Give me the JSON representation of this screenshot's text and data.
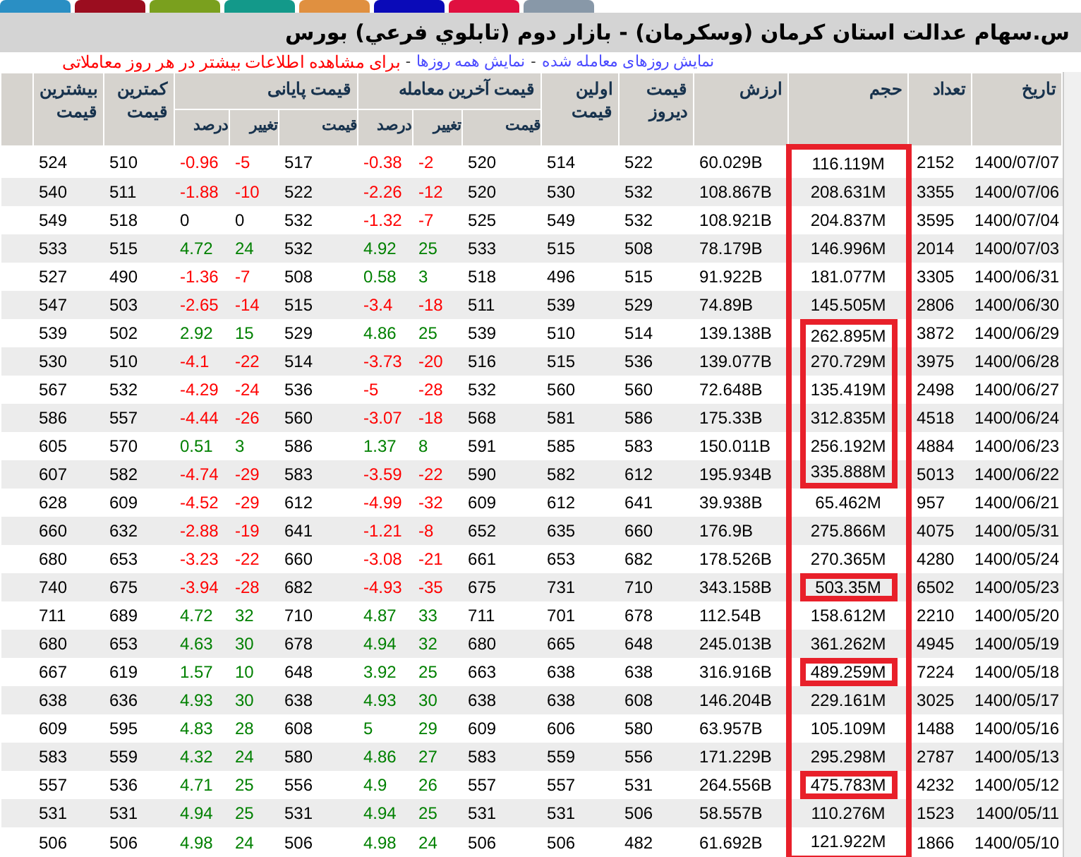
{
  "top_tabs": [
    {
      "color": "#2a8fc4"
    },
    {
      "color": "#9b0d1f"
    },
    {
      "color": "#7aa01e"
    },
    {
      "color": "#13998a"
    },
    {
      "color": "#e09040"
    },
    {
      "color": "#0a0ab8"
    },
    {
      "color": "#e01040"
    },
    {
      "color": "#8898a8"
    }
  ],
  "title": "س.سهام عدالت استان کرمان (وسکرمان) - بازار دوم (تابلوي فرعي) بورس",
  "links": [
    {
      "kind": "link",
      "text": "نمایش روزهای معامله شده"
    },
    {
      "kind": "separator",
      "text": "-"
    },
    {
      "kind": "link",
      "text": "نمایش همه روزها"
    },
    {
      "kind": "separator",
      "text": "-"
    },
    {
      "kind": "note",
      "text": "برای مشاهده اطلاعات بیشتر در هر روز معاملاتی"
    }
  ],
  "table": {
    "columns": [
      {
        "label": "تاریخ"
      },
      {
        "label": "تعداد"
      },
      {
        "label": "حجم"
      },
      {
        "label": "ارزش"
      },
      {
        "label": "قیمت دیروز"
      },
      {
        "label": "اولین قیمت"
      },
      {
        "label": "قیمت آخرین معامله",
        "sub": [
          "قیمت",
          "تغییر",
          "درصد"
        ]
      },
      {
        "label": "قیمت پایانی",
        "sub": [
          "قیمت",
          "تغییر",
          "درصد"
        ]
      },
      {
        "label": "کمترین قیمت"
      },
      {
        "label": "بیشترین قیمت"
      }
    ],
    "rows": [
      {
        "date": "1400/07/07",
        "count": "2152",
        "volume": "116.119M",
        "boxed": false,
        "value": "60.029B",
        "yesterday": "522",
        "first": "514",
        "last": {
          "price": "520",
          "change": "-2",
          "percent": "-0.38",
          "color": "#ff0000"
        },
        "close": {
          "price": "517",
          "change": "-5",
          "percent": "-0.96",
          "color": "#ff0000"
        },
        "min": "510",
        "max": "524"
      },
      {
        "date": "1400/07/06",
        "count": "3355",
        "volume": "208.631M",
        "boxed": false,
        "value": "108.867B",
        "yesterday": "532",
        "first": "530",
        "last": {
          "price": "520",
          "change": "-12",
          "percent": "-2.26",
          "color": "#ff0000"
        },
        "close": {
          "price": "522",
          "change": "-10",
          "percent": "-1.88",
          "color": "#ff0000"
        },
        "min": "511",
        "max": "540"
      },
      {
        "date": "1400/07/04",
        "count": "3595",
        "volume": "204.837M",
        "boxed": false,
        "value": "108.921B",
        "yesterday": "532",
        "first": "549",
        "last": {
          "price": "525",
          "change": "-7",
          "percent": "-1.32",
          "color": "#ff0000"
        },
        "close": {
          "price": "532",
          "change": "0",
          "percent": "0",
          "color": "#000000"
        },
        "min": "518",
        "max": "549"
      },
      {
        "date": "1400/07/03",
        "count": "2014",
        "volume": "146.996M",
        "boxed": false,
        "value": "78.179B",
        "yesterday": "508",
        "first": "515",
        "last": {
          "price": "533",
          "change": "25",
          "percent": "4.92",
          "color": "#008000"
        },
        "close": {
          "price": "532",
          "change": "24",
          "percent": "4.72",
          "color": "#008000"
        },
        "min": "515",
        "max": "533"
      },
      {
        "date": "1400/06/31",
        "count": "3305",
        "volume": "181.077M",
        "boxed": false,
        "value": "91.922B",
        "yesterday": "515",
        "first": "496",
        "last": {
          "price": "518",
          "change": "3",
          "percent": "0.58",
          "color": "#008000"
        },
        "close": {
          "price": "508",
          "change": "-7",
          "percent": "-1.36",
          "color": "#ff0000"
        },
        "min": "490",
        "max": "527"
      },
      {
        "date": "1400/06/30",
        "count": "2806",
        "volume": "145.505M",
        "boxed": false,
        "value": "74.89B",
        "yesterday": "529",
        "first": "539",
        "last": {
          "price": "511",
          "change": "-18",
          "percent": "-3.4",
          "color": "#ff0000"
        },
        "close": {
          "price": "515",
          "change": "-14",
          "percent": "-2.65",
          "color": "#ff0000"
        },
        "min": "503",
        "max": "547"
      },
      {
        "date": "1400/06/29",
        "count": "3872",
        "volume": "262.895M",
        "boxed": true,
        "value": "139.138B",
        "yesterday": "514",
        "first": "510",
        "last": {
          "price": "539",
          "change": "25",
          "percent": "4.86",
          "color": "#008000"
        },
        "close": {
          "price": "529",
          "change": "15",
          "percent": "2.92",
          "color": "#008000"
        },
        "min": "502",
        "max": "539"
      },
      {
        "date": "1400/06/28",
        "count": "3975",
        "volume": "270.729M",
        "boxed": true,
        "value": "139.077B",
        "yesterday": "536",
        "first": "515",
        "last": {
          "price": "516",
          "change": "-20",
          "percent": "-3.73",
          "color": "#ff0000"
        },
        "close": {
          "price": "514",
          "change": "-22",
          "percent": "-4.1",
          "color": "#ff0000"
        },
        "min": "510",
        "max": "530"
      },
      {
        "date": "1400/06/27",
        "count": "2498",
        "volume": "135.419M",
        "boxed": true,
        "value": "72.648B",
        "yesterday": "560",
        "first": "560",
        "last": {
          "price": "532",
          "change": "-28",
          "percent": "-5",
          "color": "#ff0000"
        },
        "close": {
          "price": "536",
          "change": "-24",
          "percent": "-4.29",
          "color": "#ff0000"
        },
        "min": "532",
        "max": "567"
      },
      {
        "date": "1400/06/24",
        "count": "4518",
        "volume": "312.835M",
        "boxed": true,
        "value": "175.33B",
        "yesterday": "586",
        "first": "581",
        "last": {
          "price": "568",
          "change": "-18",
          "percent": "-3.07",
          "color": "#ff0000"
        },
        "close": {
          "price": "560",
          "change": "-26",
          "percent": "-4.44",
          "color": "#ff0000"
        },
        "min": "557",
        "max": "586"
      },
      {
        "date": "1400/06/23",
        "count": "4884",
        "volume": "256.192M",
        "boxed": true,
        "value": "150.011B",
        "yesterday": "583",
        "first": "585",
        "last": {
          "price": "591",
          "change": "8",
          "percent": "1.37",
          "color": "#008000"
        },
        "close": {
          "price": "586",
          "change": "3",
          "percent": "0.51",
          "color": "#008000"
        },
        "min": "570",
        "max": "605"
      },
      {
        "date": "1400/06/22",
        "count": "5013",
        "volume": "335.888M",
        "boxed": true,
        "value": "195.934B",
        "yesterday": "612",
        "first": "582",
        "last": {
          "price": "590",
          "change": "-22",
          "percent": "-3.59",
          "color": "#ff0000"
        },
        "close": {
          "price": "583",
          "change": "-29",
          "percent": "-4.74",
          "color": "#ff0000"
        },
        "min": "582",
        "max": "607"
      },
      {
        "date": "1400/06/21",
        "count": "957",
        "volume": "65.462M",
        "boxed": false,
        "value": "39.938B",
        "yesterday": "641",
        "first": "612",
        "last": {
          "price": "609",
          "change": "-32",
          "percent": "-4.99",
          "color": "#ff0000"
        },
        "close": {
          "price": "612",
          "change": "-29",
          "percent": "-4.52",
          "color": "#ff0000"
        },
        "min": "609",
        "max": "628"
      },
      {
        "date": "1400/05/31",
        "count": "4075",
        "volume": "275.866M",
        "boxed": false,
        "value": "176.9B",
        "yesterday": "660",
        "first": "635",
        "last": {
          "price": "652",
          "change": "-8",
          "percent": "-1.21",
          "color": "#ff0000"
        },
        "close": {
          "price": "641",
          "change": "-19",
          "percent": "-2.88",
          "color": "#ff0000"
        },
        "min": "632",
        "max": "660"
      },
      {
        "date": "1400/05/24",
        "count": "4280",
        "volume": "270.365M",
        "boxed": false,
        "value": "178.526B",
        "yesterday": "682",
        "first": "653",
        "last": {
          "price": "661",
          "change": "-21",
          "percent": "-3.08",
          "color": "#ff0000"
        },
        "close": {
          "price": "660",
          "change": "-22",
          "percent": "-3.23",
          "color": "#ff0000"
        },
        "min": "653",
        "max": "680"
      },
      {
        "date": "1400/05/23",
        "count": "6502",
        "volume": "503.35M",
        "boxed": true,
        "value": "343.158B",
        "yesterday": "710",
        "first": "731",
        "last": {
          "price": "675",
          "change": "-35",
          "percent": "-4.93",
          "color": "#ff0000"
        },
        "close": {
          "price": "682",
          "change": "-28",
          "percent": "-3.94",
          "color": "#ff0000"
        },
        "min": "675",
        "max": "740"
      },
      {
        "date": "1400/05/20",
        "count": "2210",
        "volume": "158.612M",
        "boxed": false,
        "value": "112.54B",
        "yesterday": "678",
        "first": "701",
        "last": {
          "price": "711",
          "change": "33",
          "percent": "4.87",
          "color": "#008000"
        },
        "close": {
          "price": "710",
          "change": "32",
          "percent": "4.72",
          "color": "#008000"
        },
        "min": "689",
        "max": "711"
      },
      {
        "date": "1400/05/19",
        "count": "4945",
        "volume": "361.262M",
        "boxed": false,
        "value": "245.013B",
        "yesterday": "648",
        "first": "665",
        "last": {
          "price": "680",
          "change": "32",
          "percent": "4.94",
          "color": "#008000"
        },
        "close": {
          "price": "678",
          "change": "30",
          "percent": "4.63",
          "color": "#008000"
        },
        "min": "653",
        "max": "680"
      },
      {
        "date": "1400/05/18",
        "count": "7224",
        "volume": "489.259M",
        "boxed": true,
        "value": "316.916B",
        "yesterday": "638",
        "first": "638",
        "last": {
          "price": "663",
          "change": "25",
          "percent": "3.92",
          "color": "#008000"
        },
        "close": {
          "price": "648",
          "change": "10",
          "percent": "1.57",
          "color": "#008000"
        },
        "min": "619",
        "max": "667"
      },
      {
        "date": "1400/05/17",
        "count": "3025",
        "volume": "229.161M",
        "boxed": false,
        "value": "146.204B",
        "yesterday": "608",
        "first": "638",
        "last": {
          "price": "638",
          "change": "30",
          "percent": "4.93",
          "color": "#008000"
        },
        "close": {
          "price": "638",
          "change": "30",
          "percent": "4.93",
          "color": "#008000"
        },
        "min": "636",
        "max": "638"
      },
      {
        "date": "1400/05/16",
        "count": "1488",
        "volume": "105.109M",
        "boxed": false,
        "value": "63.957B",
        "yesterday": "580",
        "first": "606",
        "last": {
          "price": "609",
          "change": "29",
          "percent": "5",
          "color": "#008000"
        },
        "close": {
          "price": "608",
          "change": "28",
          "percent": "4.83",
          "color": "#008000"
        },
        "min": "595",
        "max": "609"
      },
      {
        "date": "1400/05/13",
        "count": "2787",
        "volume": "295.298M",
        "boxed": false,
        "value": "171.229B",
        "yesterday": "556",
        "first": "559",
        "last": {
          "price": "583",
          "change": "27",
          "percent": "4.86",
          "color": "#008000"
        },
        "close": {
          "price": "580",
          "change": "24",
          "percent": "4.32",
          "color": "#008000"
        },
        "min": "559",
        "max": "583"
      },
      {
        "date": "1400/05/12",
        "count": "4232",
        "volume": "475.783M",
        "boxed": true,
        "value": "264.556B",
        "yesterday": "531",
        "first": "557",
        "last": {
          "price": "557",
          "change": "26",
          "percent": "4.9",
          "color": "#008000"
        },
        "close": {
          "price": "556",
          "change": "25",
          "percent": "4.71",
          "color": "#008000"
        },
        "min": "536",
        "max": "557"
      },
      {
        "date": "1400/05/11",
        "count": "1523",
        "volume": "110.276M",
        "boxed": false,
        "value": "58.557B",
        "yesterday": "506",
        "first": "531",
        "last": {
          "price": "531",
          "change": "25",
          "percent": "4.94",
          "color": "#008000"
        },
        "close": {
          "price": "531",
          "change": "25",
          "percent": "4.94",
          "color": "#008000"
        },
        "min": "531",
        "max": "531"
      },
      {
        "date": "1400/05/10",
        "count": "1866",
        "volume": "121.922M",
        "boxed": false,
        "value": "61.692B",
        "yesterday": "482",
        "first": "506",
        "last": {
          "price": "506",
          "change": "24",
          "percent": "4.98",
          "color": "#008000"
        },
        "close": {
          "price": "506",
          "change": "24",
          "percent": "4.98",
          "color": "#008000"
        },
        "min": "506",
        "max": "506"
      }
    ]
  }
}
